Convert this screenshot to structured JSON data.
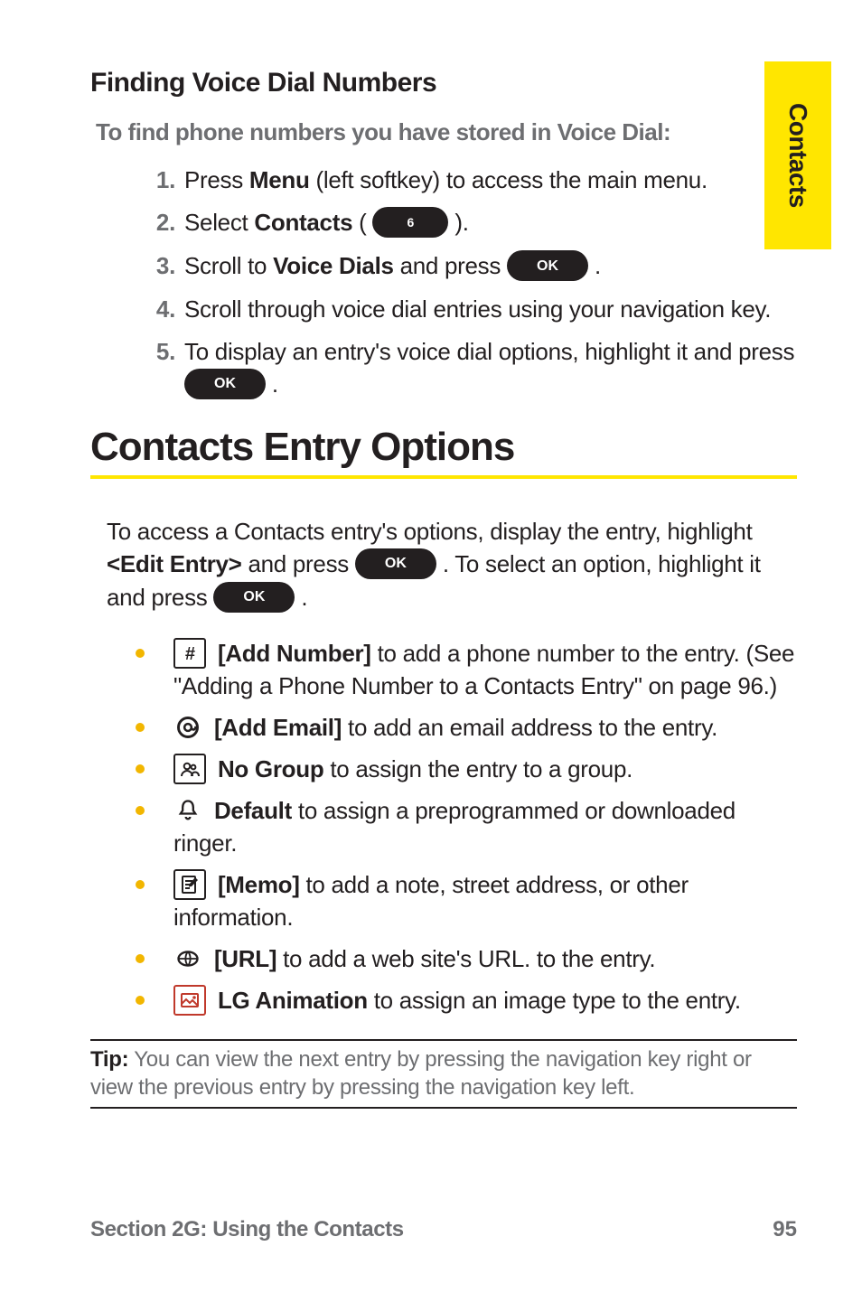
{
  "side_tab": "Contacts",
  "heading_small": "Finding Voice Dial Numbers",
  "subhead": "To find phone numbers you have stored in Voice Dial:",
  "buttons": {
    "ok": "OK",
    "six": "6"
  },
  "steps": [
    {
      "n": "1.",
      "pre": "Press ",
      "bold": "Menu",
      "post": " (left softkey) to access the main menu."
    },
    {
      "n": "2.",
      "pre": "Select ",
      "bold": "Contacts",
      "post1": " ( ",
      "btn": "six",
      "post2": " )."
    },
    {
      "n": "3.",
      "pre": "Scroll to ",
      "bold": "Voice Dials",
      "post1": " and press  ",
      "btn": "ok",
      "post2": " ."
    },
    {
      "n": "4.",
      "text": "Scroll through voice dial entries using your navigation key."
    },
    {
      "n": "5.",
      "pre": "To display an entry's voice dial options, highlight it and press ",
      "btn": "ok",
      "post2": " ."
    }
  ],
  "heading_big": "Contacts Entry Options",
  "para": {
    "p1": "To access a Contacts entry's options, display the entry, highlight ",
    "edit_entry": "<Edit Entry>",
    "p2": " and press  ",
    "p3": " . To select an option, highlight it and press  ",
    "p4": " ."
  },
  "bullets": [
    {
      "icon": "hash",
      "label": "[Add Number]",
      "text": " to add a phone number to the entry. (See \"Adding a Phone Number to a Contacts Entry\" on page 96.)"
    },
    {
      "icon": "at",
      "label": "[Add Email]",
      "text": " to add an email address to the entry."
    },
    {
      "icon": "group",
      "label": "No Group",
      "text": " to assign the entry to a group."
    },
    {
      "icon": "bell",
      "label": "Default",
      "text": " to assign a preprogrammed or downloaded ringer."
    },
    {
      "icon": "memo",
      "label": "[Memo]",
      "text": " to add a note, street address, or other information."
    },
    {
      "icon": "url",
      "label": "[URL]",
      "text": " to add a web site's URL. to the entry."
    },
    {
      "icon": "anim",
      "label": "LG Animation",
      "text": " to assign an image type to the entry."
    }
  ],
  "tip": {
    "label": "Tip:",
    "text": " You can view the next entry by pressing the navigation key right or view the previous entry by pressing the navigation key left."
  },
  "footer": {
    "section": "Section 2G: Using the Contacts",
    "page": "95"
  }
}
